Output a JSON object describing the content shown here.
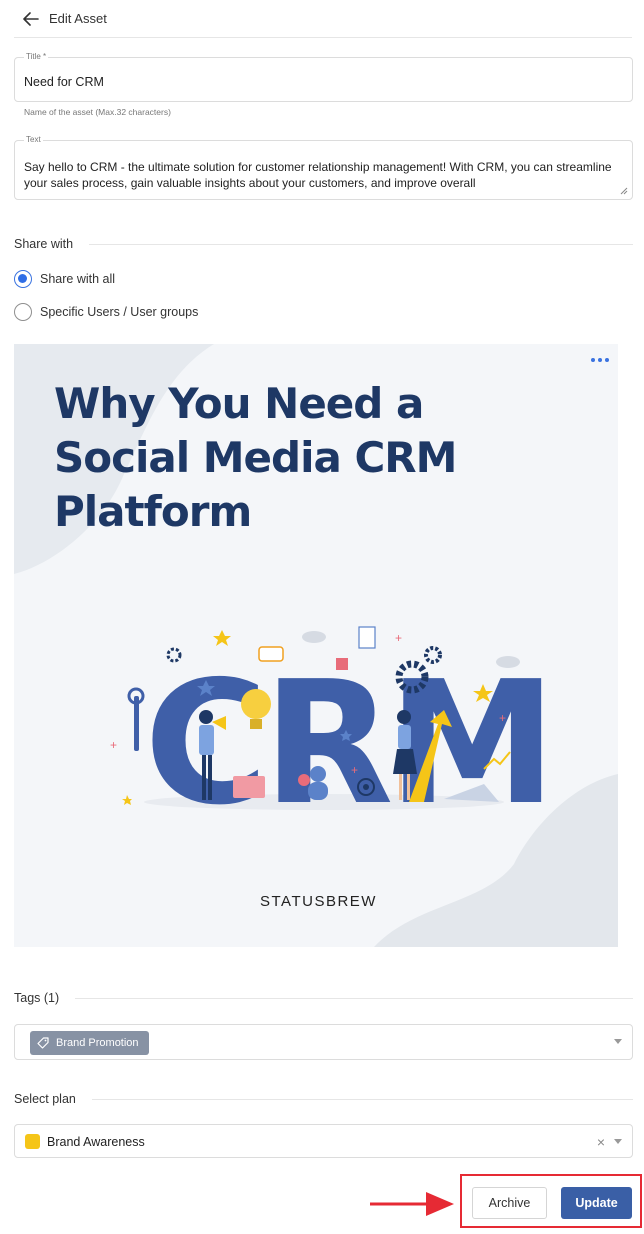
{
  "header": {
    "title": "Edit Asset"
  },
  "title_field": {
    "label": "Title *",
    "value": "Need for CRM",
    "hint": "Name of the asset (Max.32 characters)"
  },
  "text_field": {
    "label": "Text",
    "value": "Say hello to CRM - the ultimate solution for customer relationship management! With CRM, you can streamline your sales process, gain valuable insights about your customers, and improve overall"
  },
  "share": {
    "section_title": "Share with",
    "options": [
      {
        "label": "Share with all",
        "selected": true
      },
      {
        "label": "Specific Users / User groups",
        "selected": false
      }
    ]
  },
  "asset_image": {
    "headline": "Why You Need a Social Media CRM Platform",
    "big_letters": "CRM",
    "brand": "STATUSBREW"
  },
  "tags": {
    "section_title": "Tags (1)",
    "items": [
      "Brand Promotion"
    ]
  },
  "plan": {
    "section_title": "Select plan",
    "value": "Brand Awareness",
    "swatch_color": "#f5c518"
  },
  "actions": {
    "archive_label": "Archive",
    "update_label": "Update"
  },
  "colors": {
    "accent": "#3a5fa6",
    "radio": "#2f6ee6",
    "highlight": "#e62a34",
    "navy": "#1e3865"
  }
}
